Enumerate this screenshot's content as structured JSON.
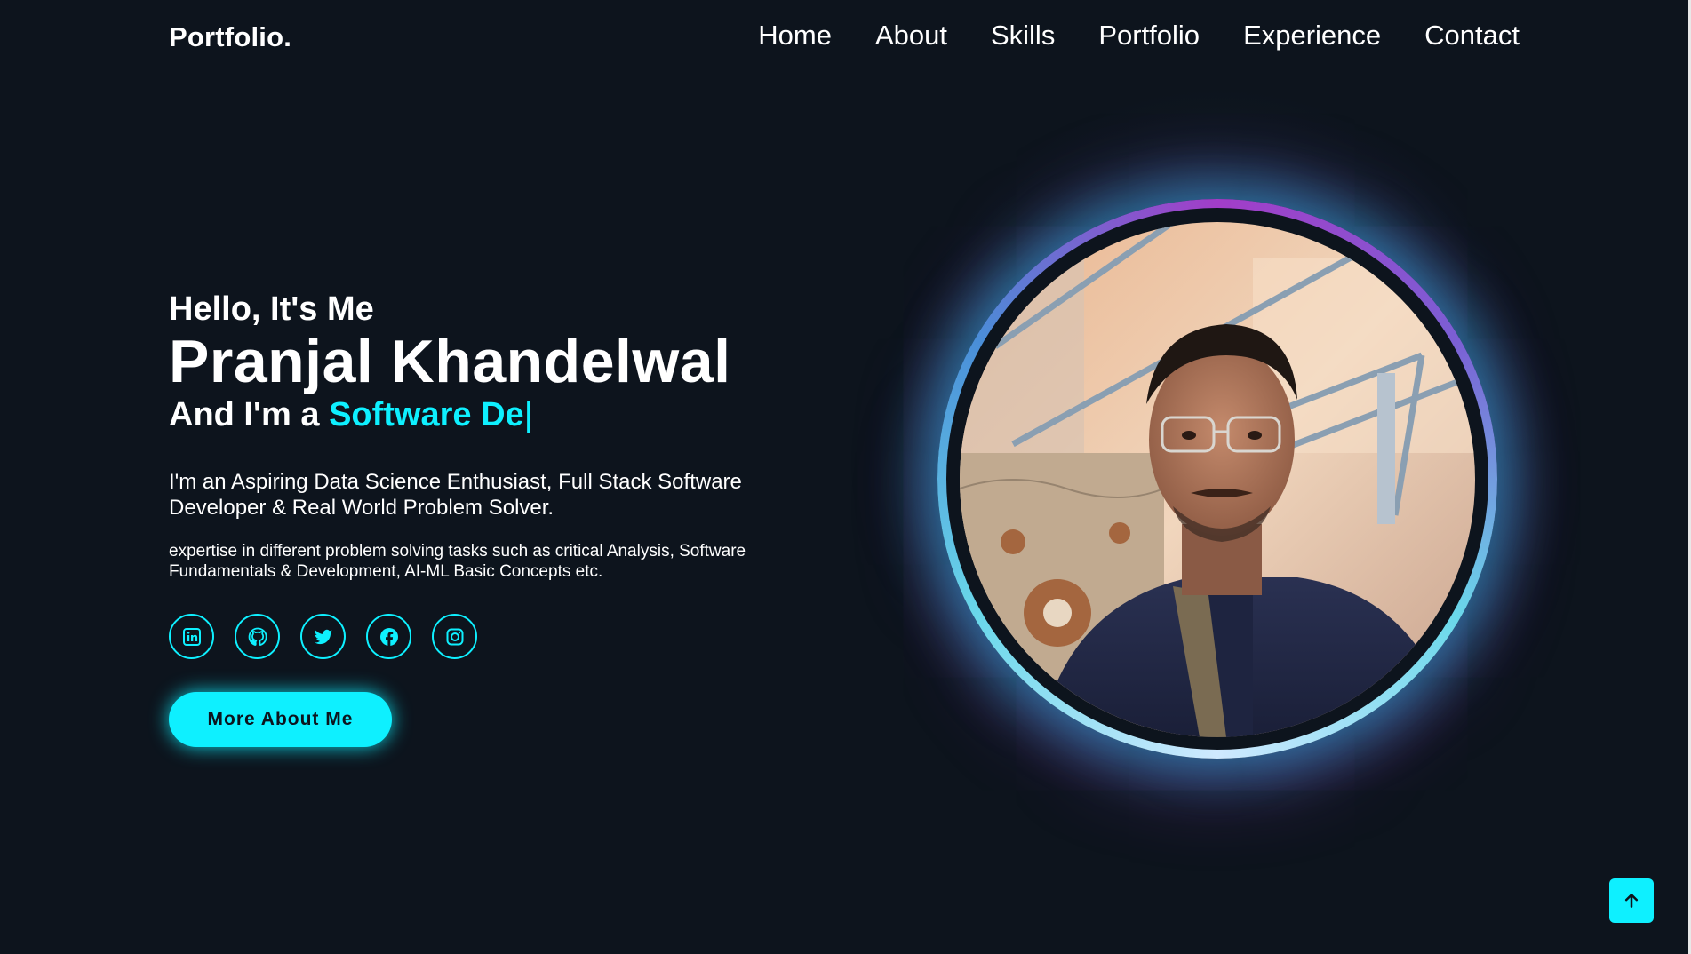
{
  "header": {
    "logo": "Portfolio.",
    "nav": [
      "Home",
      "About",
      "Skills",
      "Portfolio",
      "Experience",
      "Contact"
    ]
  },
  "hero": {
    "greeting": "Hello, It's Me",
    "name": "Pranjal Khandelwal",
    "role_prefix": "And I'm a ",
    "role_typed": "Software De",
    "cursor": "|",
    "lead": "I'm an Aspiring Data Science Enthusiast, Full Stack Software Developer & Real World Problem Solver.",
    "description": "expertise in different problem solving tasks such as critical Analysis, Software Fundamentals & Development, AI-ML Basic Concepts etc.",
    "cta_label": "More About Me"
  },
  "socials": [
    {
      "icon": "linkedin-icon"
    },
    {
      "icon": "github-icon"
    },
    {
      "icon": "twitter-icon"
    },
    {
      "icon": "facebook-icon"
    },
    {
      "icon": "instagram-icon"
    }
  ],
  "colors": {
    "background": "#0d141d",
    "accent": "#0ef0ff",
    "ring_purple": "#a23dc8",
    "text": "#ffffff"
  },
  "scroll_top": {
    "icon": "arrow-up-icon"
  }
}
